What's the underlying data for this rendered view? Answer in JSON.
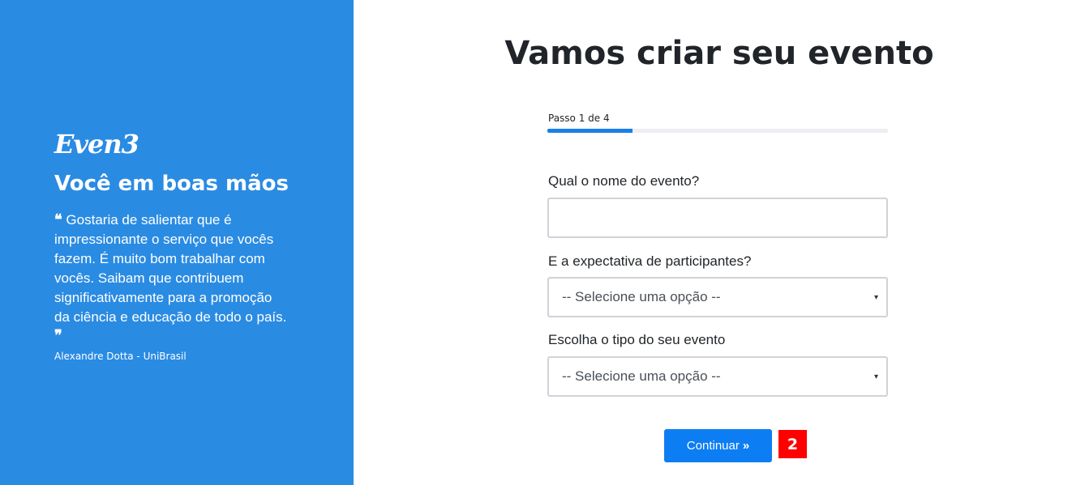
{
  "brand": {
    "logo": "Even3",
    "tagline": "Você em boas mãos",
    "quote": "Gostaria de salientar que é impressionante o serviço que vocês fazem. É muito bom trabalhar com vocês. Saibam que contribuem significativamente para a promoção da ciência e educação de todo o país.",
    "quote_open": "❝",
    "quote_close": "❞",
    "author": "Alexandre Dotta - UniBrasil"
  },
  "form": {
    "title": "Vamos criar seu evento",
    "step_label": "Passo 1 de 4",
    "progress_fraction": 0.25,
    "progress_color": "#1a7fe6",
    "event_name_label": "Qual o nome do evento?",
    "event_name_value": "",
    "participants_label": "E a expectativa de participantes?",
    "participants_value": "-- Selecione uma opção --",
    "event_type_label": "Escolha o tipo do seu evento",
    "event_type_value": "-- Selecione uma opção --",
    "caret_icon": "▾",
    "continue_label": "Continuar",
    "continue_icon": "»"
  },
  "badge": {
    "label": "2"
  },
  "colors": {
    "panel": "#2a8be3",
    "button": "#0d7df4",
    "badge": "#ff0000"
  }
}
